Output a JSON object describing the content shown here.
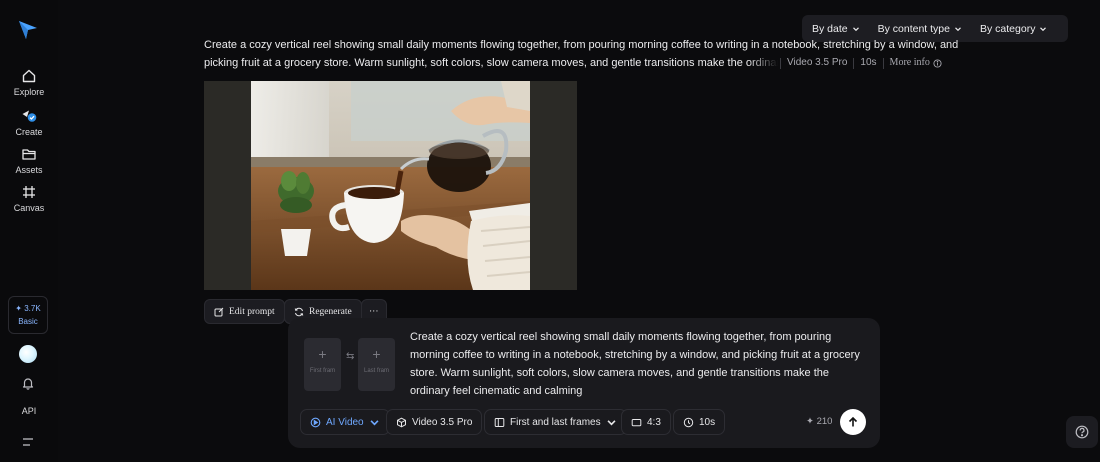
{
  "sidebar": {
    "logo_icon": "paper-plane-logo",
    "items": [
      {
        "label": "Explore",
        "icon": "home-icon"
      },
      {
        "label": "Create",
        "icon": "create-icon"
      },
      {
        "label": "Assets",
        "icon": "folder-icon"
      },
      {
        "label": "Canvas",
        "icon": "canvas-icon"
      }
    ],
    "credits": {
      "amount": "✦ 3.7K",
      "plan": "Basic"
    },
    "api_label": "API"
  },
  "filters": [
    {
      "label": "By date"
    },
    {
      "label": "By content type"
    },
    {
      "label": "By category"
    }
  ],
  "generation": {
    "prompt_line1": "Create a cozy vertical reel showing small daily moments flowing together, from pouring morning coffee to writing in a notebook, stretching by a window, and",
    "prompt_line2": "picking fruit at a grocery store. Warm sunlight, soft colors, slow camera moves, and gentle transitions make the ordinary fe",
    "model": "Video 3.5 Pro",
    "duration": "10s",
    "more_info": "More info",
    "actions": {
      "edit": "Edit prompt",
      "regenerate": "Regenerate",
      "more": "···"
    }
  },
  "composer": {
    "first_frame": "First fram",
    "last_frame": "Last fram",
    "swap": "⇆",
    "prompt": "Create a cozy vertical reel showing small daily moments flowing together, from pouring morning coffee to writing in a notebook, stretching by a window, and picking fruit at a grocery store. Warm sunlight, soft colors, slow camera moves, and gentle transitions make the ordinary feel cinematic and calming",
    "mode": "AI Video",
    "model": "Video 3.5 Pro",
    "frames_mode": "First and last frames",
    "aspect": "4:3",
    "duration": "10s",
    "cost": "✦ 210"
  },
  "colors": {
    "background": "#0b0b0d",
    "panel": "#1a1a1e",
    "accent": "#6fa8ff"
  }
}
